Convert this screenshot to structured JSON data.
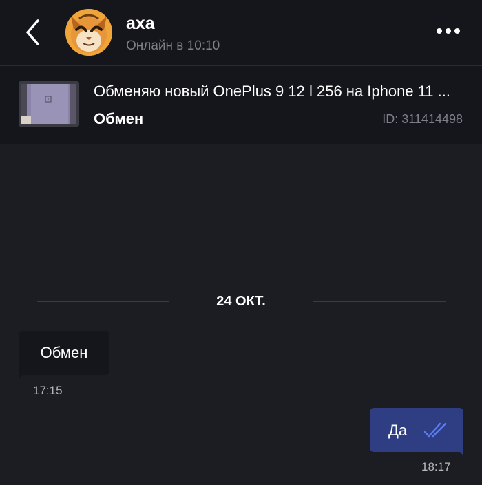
{
  "header": {
    "back_icon": "chevron-left-icon",
    "contact_name": "аха",
    "contact_status": "Онлайн в 10:10",
    "more_icon": "more-horizontal-icon"
  },
  "listing": {
    "title": "Обменяю новый OnePlus 9 12 l 256 на Iphone 11 ...",
    "category": "Обмен",
    "id_label": "ID: 311414498"
  },
  "chat": {
    "date_separator": "24 ОКТ.",
    "messages": [
      {
        "direction": "incoming",
        "text": "Обмен",
        "time": "17:15"
      },
      {
        "direction": "outgoing",
        "text": "Да",
        "time": "18:17",
        "status": "read",
        "status_icon": "double-check-icon"
      }
    ]
  },
  "colors": {
    "background": "#1c1d22",
    "panel": "#15161b",
    "outgoing_bubble": "#2f3e83",
    "read_tick": "#5b7cf0",
    "secondary_text": "#7d8089"
  }
}
